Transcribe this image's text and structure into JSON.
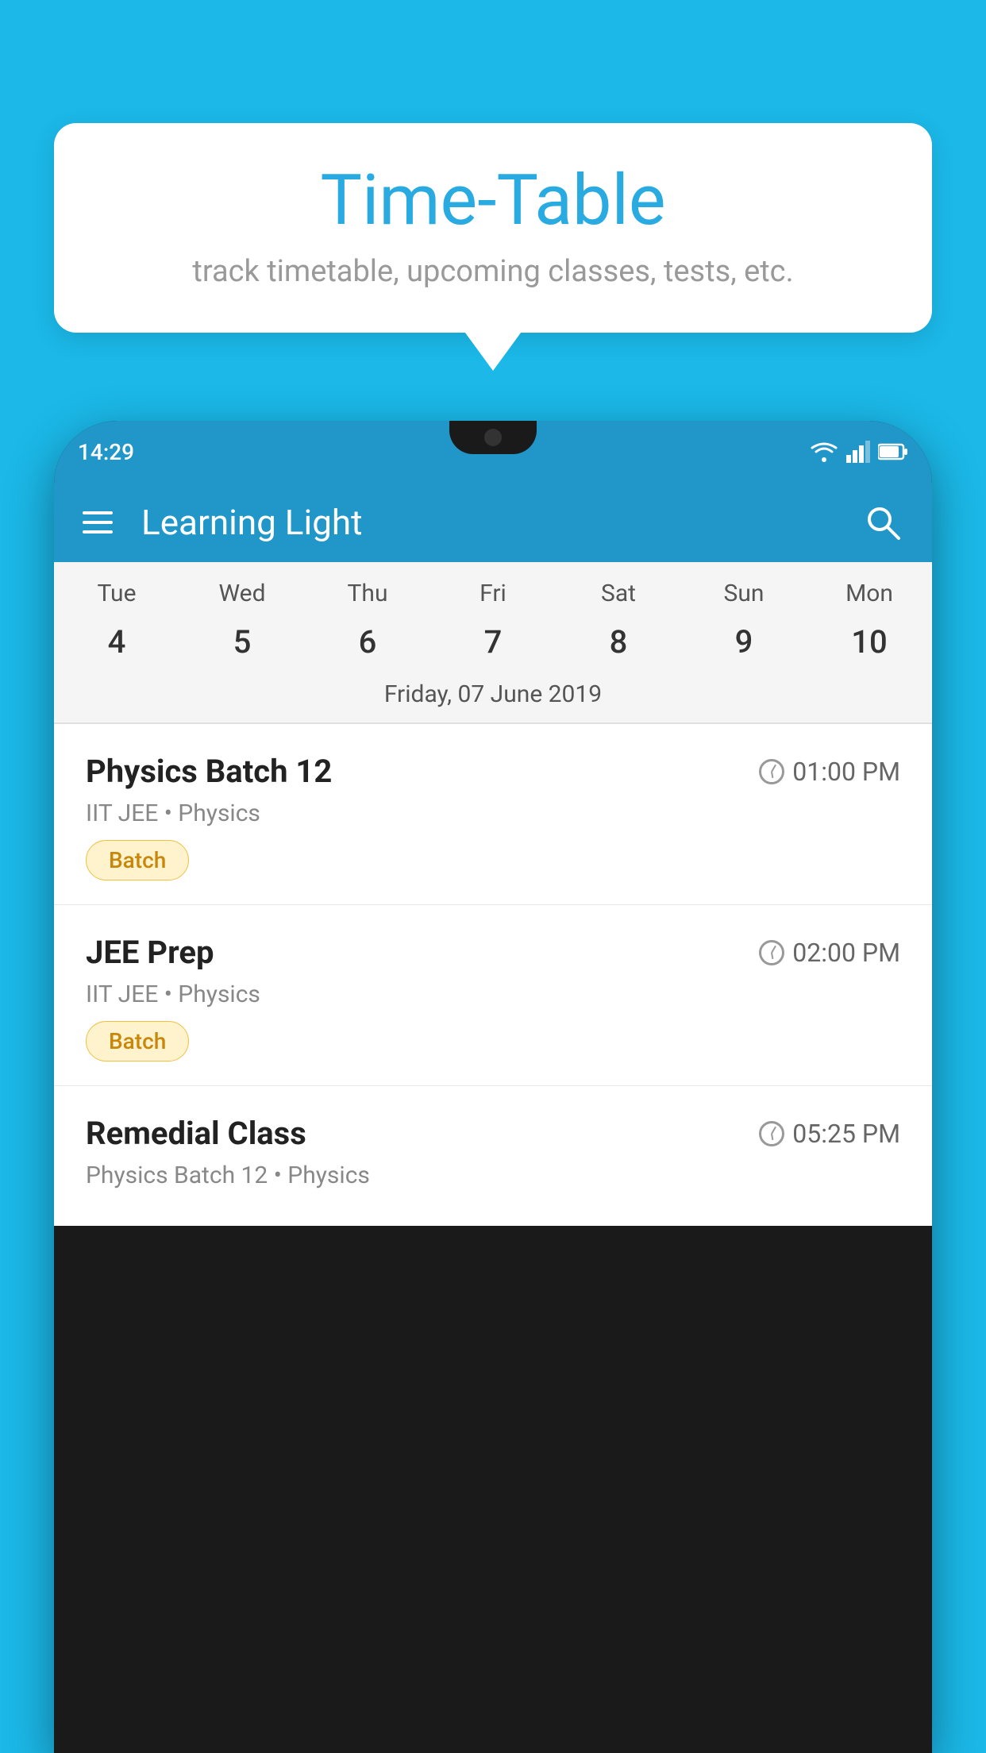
{
  "background_color": "#1BB8E8",
  "speech_bubble": {
    "title": "Time-Table",
    "subtitle": "track timetable, upcoming classes, tests, etc."
  },
  "status_bar": {
    "time": "14:29"
  },
  "app_header": {
    "title": "Learning Light"
  },
  "calendar": {
    "days": [
      {
        "name": "Tue",
        "number": "4",
        "state": "normal"
      },
      {
        "name": "Wed",
        "number": "5",
        "state": "normal"
      },
      {
        "name": "Thu",
        "number": "6",
        "state": "today"
      },
      {
        "name": "Fri",
        "number": "7",
        "state": "selected"
      },
      {
        "name": "Sat",
        "number": "8",
        "state": "normal"
      },
      {
        "name": "Sun",
        "number": "9",
        "state": "normal"
      },
      {
        "name": "Mon",
        "number": "10",
        "state": "normal"
      }
    ],
    "selected_date_label": "Friday, 07 June 2019"
  },
  "schedule": [
    {
      "title": "Physics Batch 12",
      "time": "01:00 PM",
      "meta": "IIT JEE • Physics",
      "badge": "Batch"
    },
    {
      "title": "JEE Prep",
      "time": "02:00 PM",
      "meta": "IIT JEE • Physics",
      "badge": "Batch"
    },
    {
      "title": "Remedial Class",
      "time": "05:25 PM",
      "meta": "Physics Batch 12 • Physics",
      "badge": ""
    }
  ]
}
